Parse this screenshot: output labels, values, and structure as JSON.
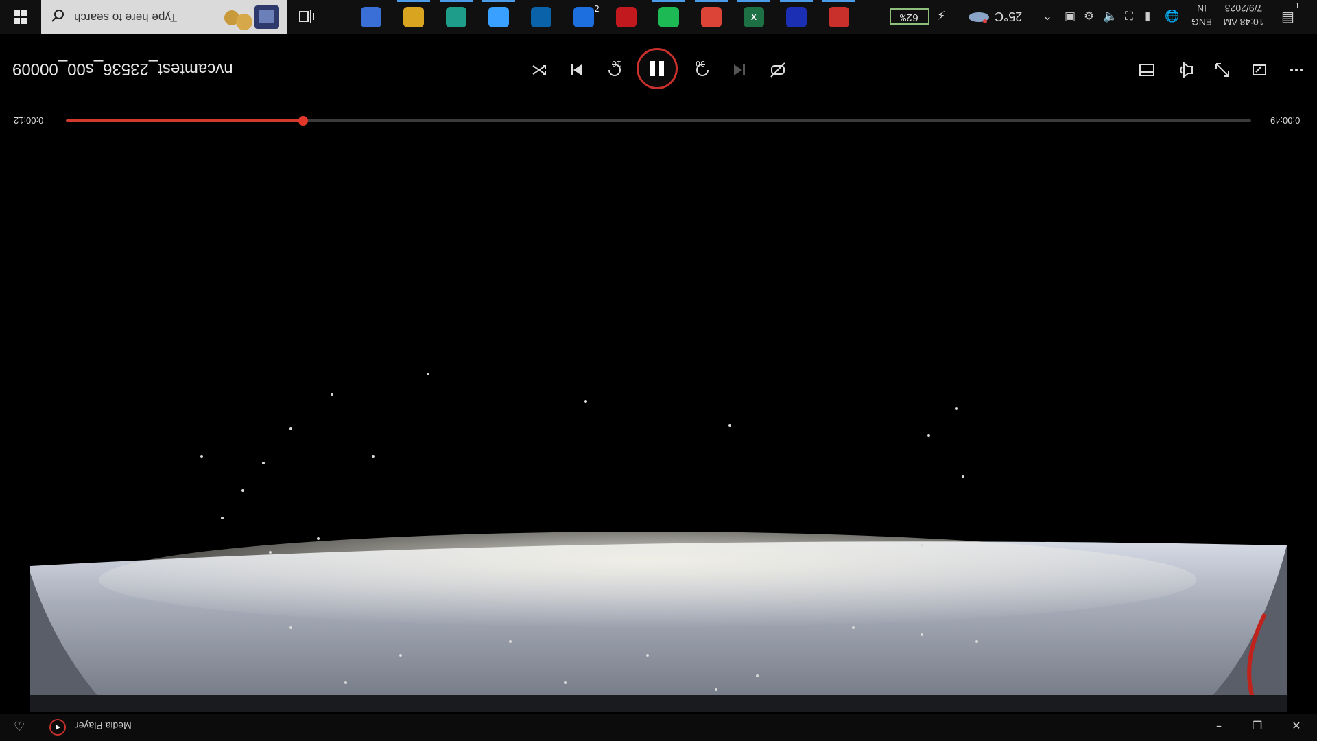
{
  "taskbar": {
    "search_placeholder": "Type here to search",
    "pinned_apps": [
      {
        "icon": "cube-app-icon",
        "color": "#3a6fd8",
        "label": "",
        "active": false
      },
      {
        "icon": "file-explorer-icon",
        "color": "#d9a521",
        "label": "",
        "active": true
      },
      {
        "icon": "edge-icon",
        "color": "#1f9d8b",
        "label": "",
        "active": true
      },
      {
        "icon": "cortana-ring-icon",
        "color": "#3aa0ff",
        "label": "",
        "active": true
      },
      {
        "icon": "store-icon",
        "color": "#0a63a8",
        "label": "",
        "active": false
      },
      {
        "icon": "vpn-app-icon",
        "color": "#1d6fe0",
        "label": "",
        "active": false,
        "badge": "2"
      },
      {
        "icon": "red-app-icon",
        "color": "#c2191f",
        "label": "",
        "active": false
      },
      {
        "icon": "spotify-icon",
        "color": "#1db954",
        "label": "",
        "active": true
      },
      {
        "icon": "chrome-icon",
        "color": "#db4437",
        "label": "",
        "active": true
      },
      {
        "icon": "excel-icon",
        "color": "#1d7044",
        "label": "X",
        "active": true
      },
      {
        "icon": "blue-app-icon",
        "color": "#1b2fb5",
        "label": "",
        "active": true
      },
      {
        "icon": "media-player-icon",
        "color": "#c9302c",
        "label": "",
        "active": true
      }
    ],
    "battery": "62%",
    "temperature": "25°C",
    "language_top": "IN",
    "language_bottom": "ENG",
    "date": "7/9/2023",
    "time": "10:48 AM",
    "notification_count": "1"
  },
  "player": {
    "title": "nvcamtest_23536_s00_00009",
    "elapsed": "0:00:12",
    "duration": "0:00:49",
    "progress": 0.2,
    "skip_back_seconds": "10",
    "skip_forward_seconds": "30",
    "accent_color": "#d13a2d"
  },
  "window": {
    "app_name": "Media Player"
  }
}
